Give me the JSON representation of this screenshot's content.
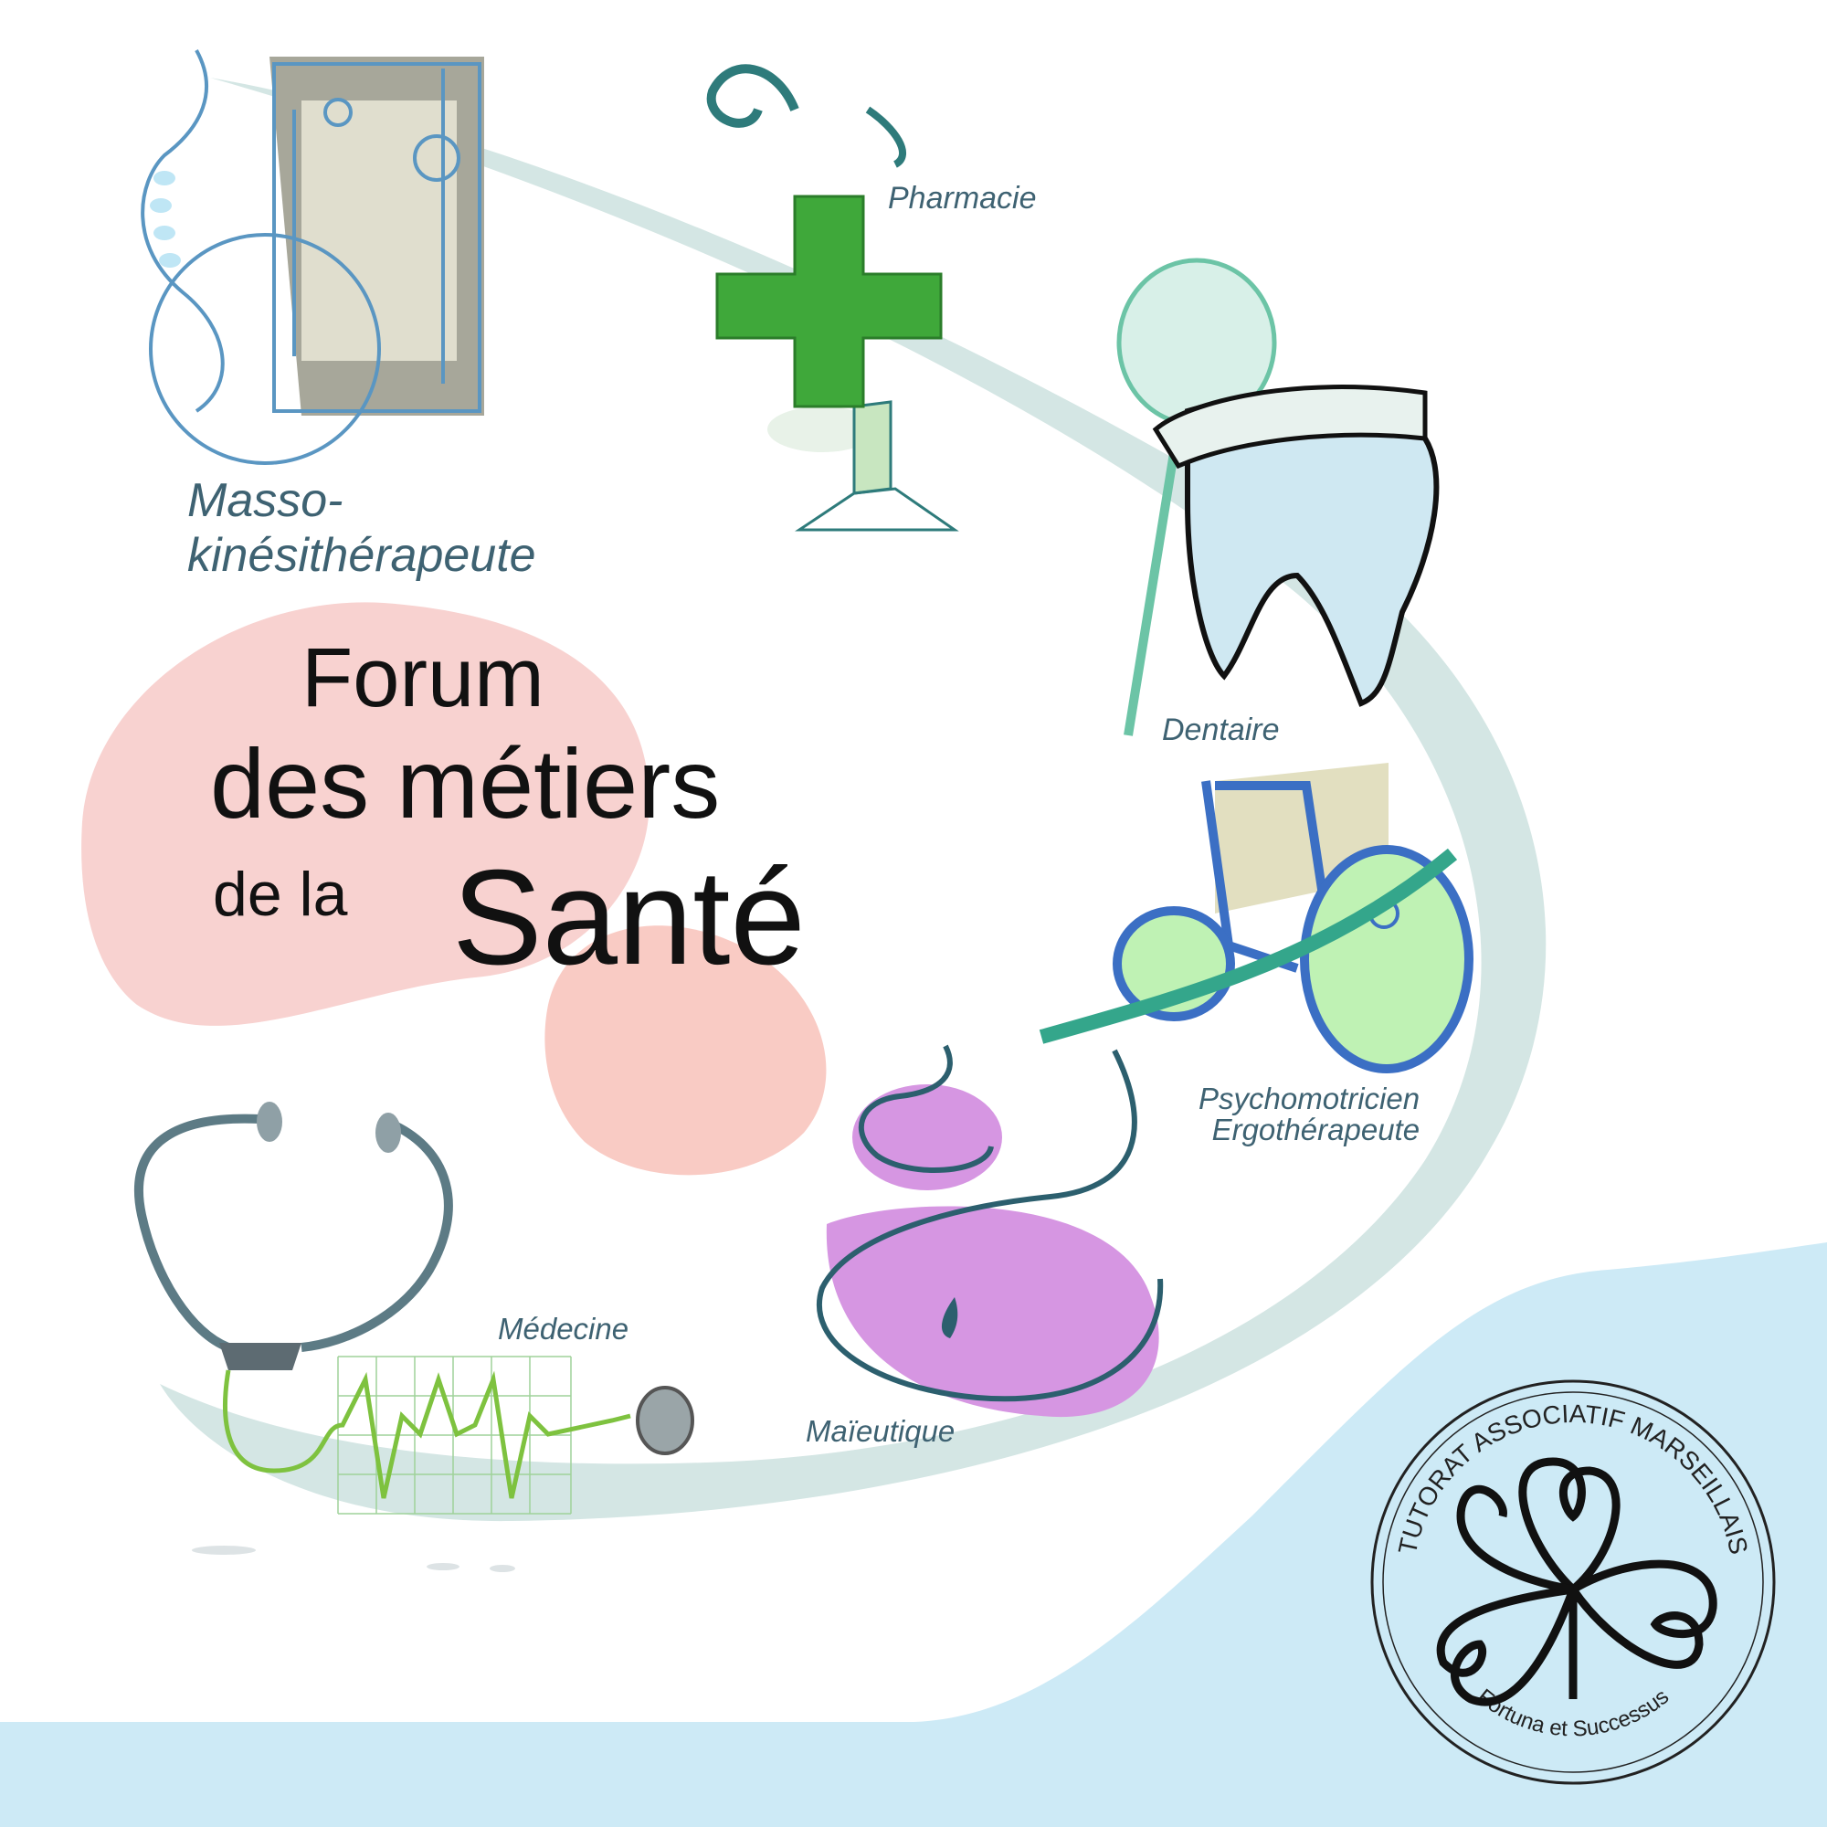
{
  "title": {
    "line1": "Forum",
    "line2": "des métiers",
    "line3a": "de la",
    "line3b": "Santé"
  },
  "labels": {
    "masso_1": "Masso-",
    "masso_2": "kinésithérapeute",
    "pharmacie": "Pharmacie",
    "dentaire": "Dentaire",
    "psychomotricien": "Psychomotricien",
    "ergotherapeute": "Ergothérapeute",
    "medecine": "Médecine",
    "maieutique": "Maïeutique"
  },
  "seal": {
    "top_text": "TUTORAT ASSOCIATIF MARSEILLAIS",
    "bottom_text": "Fortuna et Successus",
    "icon": "clover-icon"
  },
  "colors": {
    "swoosh": "#d4e6e4",
    "wave": "#cdeaf6",
    "blob_pink": "#f8d2d0",
    "pharmacy_green": "#3fa83a",
    "maieutique_purple": "#d696e2",
    "label_text": "#3e6272",
    "title_text": "#111111"
  }
}
